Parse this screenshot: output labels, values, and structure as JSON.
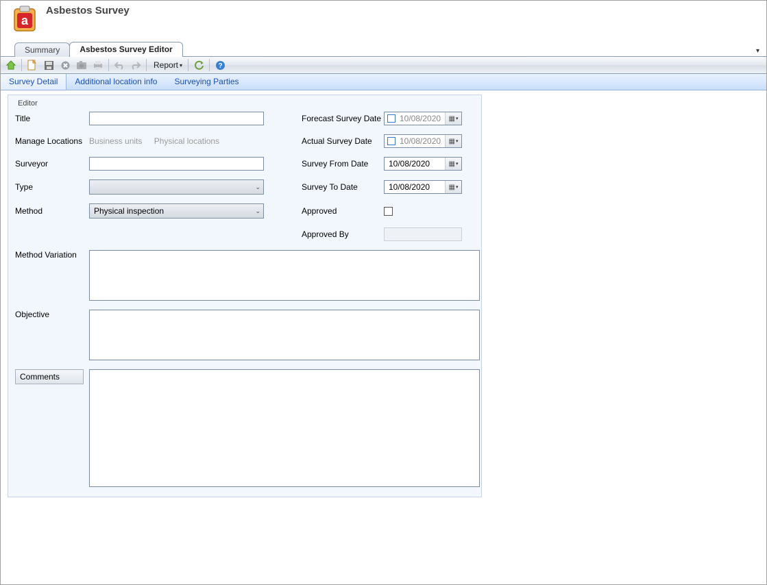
{
  "header": {
    "title": "Asbestos Survey"
  },
  "main_tabs": {
    "summary": "Summary",
    "editor": "Asbestos Survey Editor",
    "active_index": 1
  },
  "toolbar": {
    "report": "Report"
  },
  "sub_tabs": {
    "survey_detail": "Survey Detail",
    "additional_location": "Additional location info",
    "surveying_parties": "Surveying Parties",
    "active_index": 0
  },
  "editor": {
    "legend": "Editor",
    "labels": {
      "title": "Title",
      "manage_locations": "Manage Locations",
      "surveyor": "Surveyor",
      "type": "Type",
      "method": "Method",
      "method_variation": "Method Variation",
      "objective": "Objective",
      "comments": "Comments",
      "forecast_date": "Forecast Survey Date",
      "actual_date": "Actual Survey Date",
      "from_date": "Survey From Date",
      "to_date": "Survey To Date",
      "approved": "Approved",
      "approved_by": "Approved By"
    },
    "links": {
      "business_units": "Business units",
      "physical_locations": "Physical locations"
    },
    "values": {
      "title": "",
      "surveyor": "",
      "type": "",
      "method": "Physical inspection",
      "forecast_date": "10/08/2020",
      "actual_date": "10/08/2020",
      "from_date": "10/08/2020",
      "to_date": "10/08/2020",
      "approved": false,
      "approved_by": "",
      "method_variation": "",
      "objective": "",
      "comments": ""
    }
  }
}
